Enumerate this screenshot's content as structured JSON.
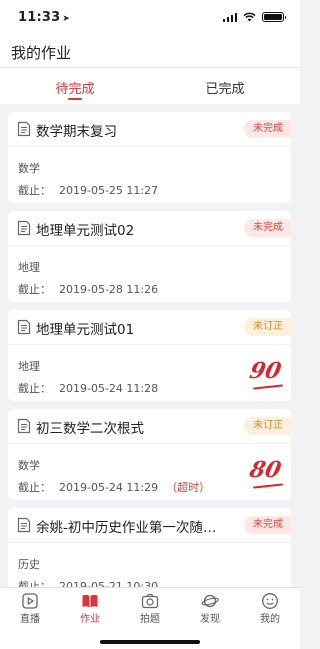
{
  "status_bar": {
    "time": "11:33"
  },
  "header": {
    "title": "我的作业"
  },
  "tabs": [
    {
      "label": "待完成",
      "active": true
    },
    {
      "label": "已完成",
      "active": false
    }
  ],
  "assignments": [
    {
      "title": "数学期末复习",
      "badge": "未完成",
      "badge_color": "#e0453b",
      "subject": "数学",
      "deadline_label": "截止：",
      "deadline": "2019-05-25 11:27",
      "overtime": "",
      "score": ""
    },
    {
      "title": "地理单元测试02",
      "badge": "未完成",
      "badge_color": "#e0453b",
      "subject": "地理",
      "deadline_label": "截止：",
      "deadline": "2019-05-28 11:26",
      "overtime": "",
      "score": ""
    },
    {
      "title": "地理单元测试01",
      "badge": "未订正",
      "badge_color": "#e08a25",
      "subject": "地理",
      "deadline_label": "截止：",
      "deadline": "2019-05-24 11:28",
      "overtime": "",
      "score": "90"
    },
    {
      "title": "初三数学二次根式",
      "badge": "未订正",
      "badge_color": "#e08a25",
      "subject": "数学",
      "deadline_label": "截止：",
      "deadline": "2019-05-24 11:29",
      "overtime": "（超时）",
      "score": "80"
    },
    {
      "title": "余姚-初中历史作业第一次随堂…",
      "badge": "未完成",
      "badge_color": "#e0453b",
      "subject": "历史",
      "deadline_label": "截止：",
      "deadline": "2019-05-21 10:30",
      "overtime": "",
      "score": ""
    }
  ],
  "bottom_nav": [
    {
      "label": "直播",
      "icon": "play-icon",
      "active": false
    },
    {
      "label": "作业",
      "icon": "book-icon",
      "active": true
    },
    {
      "label": "拍题",
      "icon": "camera-icon",
      "active": false
    },
    {
      "label": "发现",
      "icon": "planet-icon",
      "active": false
    },
    {
      "label": "我的",
      "icon": "smiley-icon",
      "active": false
    }
  ],
  "colors": {
    "accent": "#d9363e",
    "background": "#f2f2f4"
  }
}
